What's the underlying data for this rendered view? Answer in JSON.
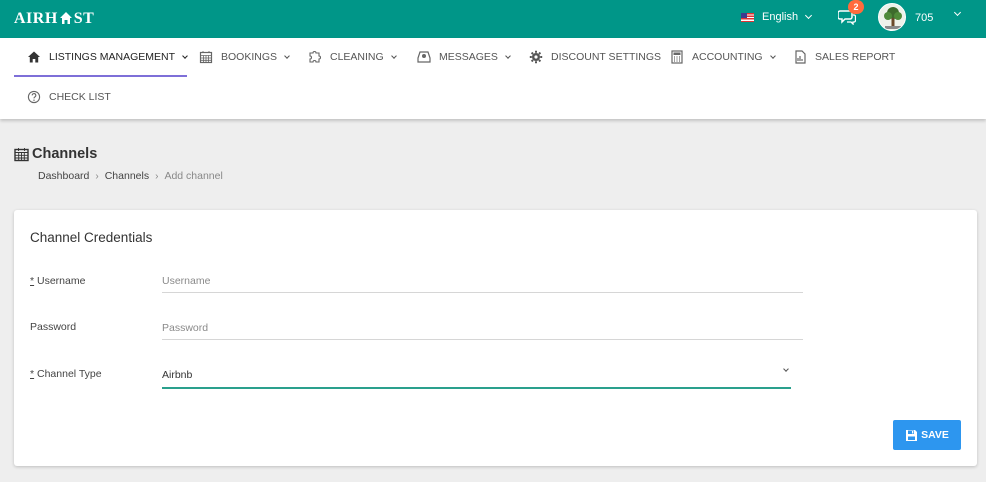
{
  "header": {
    "logo_text_left": "AIRH",
    "logo_text_right": "ST",
    "language": "English",
    "messages_badge": "2",
    "user_name": "705",
    "brand_color": "#009688",
    "badge_color": "#ff6b3d"
  },
  "nav": {
    "items": [
      {
        "label": "Listings Management",
        "icon": "home-icon",
        "dropdown": true,
        "active": true
      },
      {
        "label": "Bookings",
        "icon": "calendar-icon",
        "dropdown": true
      },
      {
        "label": "Cleaning",
        "icon": "puzzle-icon",
        "dropdown": true
      },
      {
        "label": "Messages",
        "icon": "inbox-icon",
        "dropdown": true
      },
      {
        "label": "Discount Settings",
        "icon": "gear-icon",
        "dropdown": false
      },
      {
        "label": "Accounting",
        "icon": "calculator-icon",
        "dropdown": true
      },
      {
        "label": "Sales Report",
        "icon": "report-icon",
        "dropdown": false
      },
      {
        "label": "Check List",
        "icon": "question-circle-icon",
        "dropdown": false
      }
    ]
  },
  "page": {
    "title": "Channels",
    "breadcrumb": [
      "Dashboard",
      "Channels",
      "Add channel"
    ]
  },
  "form": {
    "title": "Channel Credentials",
    "username": {
      "required_mark": "*",
      "label": " Username",
      "placeholder": "Username",
      "value": ""
    },
    "password": {
      "label": "Password",
      "placeholder": "Password",
      "value": ""
    },
    "channel_type": {
      "required_mark": "*",
      "label": " Channel Type",
      "value": "Airbnb"
    },
    "save_label": "SAVE",
    "save_color": "#2d96ef",
    "focus_color": "#2aa08d"
  }
}
